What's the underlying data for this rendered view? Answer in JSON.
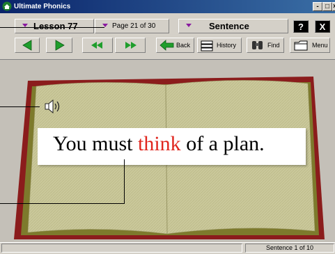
{
  "window": {
    "title": "Ultimate Phonics",
    "minimize": "-",
    "maximize": "□",
    "close": "×"
  },
  "header": {
    "lesson": "Lesson 77",
    "page": "Page 21 of 30",
    "mode": "Sentence",
    "help_label": "?",
    "exit_label": "X"
  },
  "toolbar": {
    "back_label": "Back",
    "history_label": "History",
    "find_label": "Find",
    "menu_label": "Menu"
  },
  "content": {
    "sentence_before": "You must ",
    "sentence_highlight": "think",
    "sentence_after": " of a plan."
  },
  "status": {
    "left": "",
    "right": "Sentence  1 of 10"
  },
  "colors": {
    "highlight": "#e0261e",
    "arrow_green": "#1f9e2c",
    "book_cover": "#8b1c1c",
    "page": "#c9c89a"
  }
}
